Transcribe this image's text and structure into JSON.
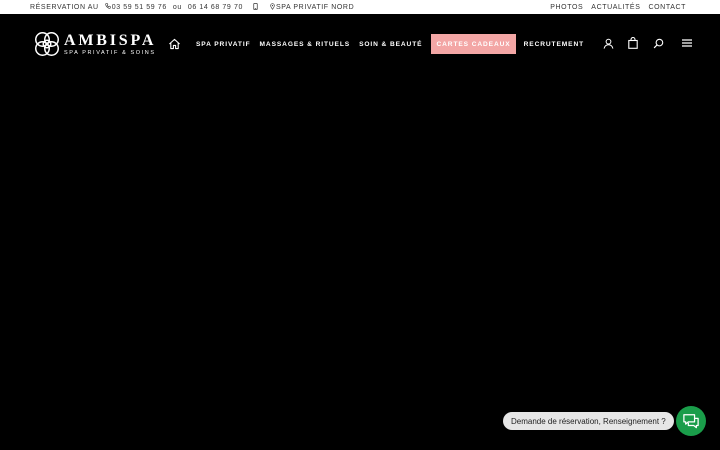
{
  "topbar": {
    "reservation_label": "RÉSERVATION AU",
    "phone_1": "03 59 51 59 76",
    "or_text": "ou",
    "phone_2": "06 14 68 79 70",
    "location_label": "SPA PRIVATIF NORD",
    "links": [
      "PHOTOS",
      "ACTUALITÉS",
      "CONTACT"
    ]
  },
  "header": {
    "brand": "AMBISPA",
    "tagline": "SPA PRIVATIF & SOINS",
    "nav": [
      {
        "label": "SPA PRIVATIF"
      },
      {
        "label": "MASSAGES & RITUELS"
      },
      {
        "label": "SOIN & BEAUTÉ"
      },
      {
        "label": "CARTES CADEAUX",
        "active": true
      },
      {
        "label": "RECRUTEMENT"
      }
    ]
  },
  "chat": {
    "prompt": "Demande de réservation, Renseignement ?"
  },
  "colors": {
    "background": "#000000",
    "accent": "#f3a6a5",
    "chat_button": "#1a9d4a"
  }
}
